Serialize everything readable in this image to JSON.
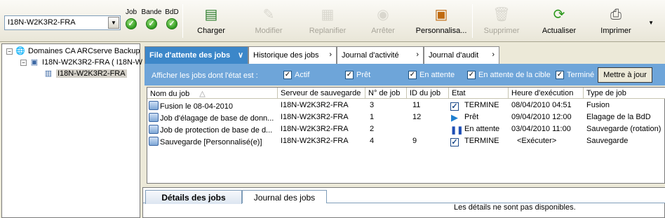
{
  "toolbar": {
    "server_value": "I18N-W2K3R2-FRA",
    "status": [
      {
        "label": "Job",
        "icon": "status-ok-icon"
      },
      {
        "label": "Bande",
        "icon": "status-ok-icon"
      },
      {
        "label": "BdD",
        "icon": "status-ok-icon"
      }
    ],
    "buttons": [
      {
        "label": "Charger",
        "icon": "load-icon",
        "enabled": true
      },
      {
        "label": "Modifier",
        "icon": "edit-icon",
        "enabled": false
      },
      {
        "label": "Replanifier",
        "icon": "reschedule-icon",
        "enabled": false
      },
      {
        "label": "Arrêter",
        "icon": "stop-icon",
        "enabled": false
      },
      {
        "label": "Personnalisa...",
        "icon": "customize-icon",
        "enabled": true
      },
      {
        "label": "Supprimer",
        "icon": "delete-icon",
        "enabled": false
      },
      {
        "label": "Actualiser",
        "icon": "refresh-icon",
        "enabled": true
      },
      {
        "label": "Imprimer",
        "icon": "print-icon",
        "enabled": true
      }
    ]
  },
  "tree": {
    "root": "Domaines CA ARCserve Backup",
    "domain": "I18N-W2K3R2-FRA ( I18N-W",
    "server": "I18N-W2K3R2-FRA"
  },
  "tabs": [
    {
      "label": "File d'attente des jobs",
      "active": true
    },
    {
      "label": "Historique des jobs",
      "active": false
    },
    {
      "label": "Journal d'activité",
      "active": false
    },
    {
      "label": "Journal d'audit",
      "active": false
    }
  ],
  "filter": {
    "title": "Afficher les jobs dont l'état est :",
    "options": [
      {
        "label": "Actif",
        "checked": true
      },
      {
        "label": "Prêt",
        "checked": true
      },
      {
        "label": "En attente",
        "checked": true
      },
      {
        "label": "En attente de la cible",
        "checked": true
      },
      {
        "label": "Terminé",
        "checked": true
      }
    ],
    "update_button": "Mettre à jour"
  },
  "grid": {
    "columns": [
      "Nom du job",
      "Serveur de sauvegarde",
      "N° de job",
      "ID du job",
      "Etat",
      "Heure d'exécution",
      "Type de job"
    ],
    "rows": [
      {
        "name": "Fusion le 08-04-2010",
        "server": "I18N-W2K3R2-FRA",
        "job_no": "3",
        "job_id": "11",
        "state": "TERMINE",
        "state_icon": "done-check-icon",
        "time": "08/04/2010  04:51",
        "type": "Fusion"
      },
      {
        "name": "Job d'élagage de base de donn...",
        "server": "I18N-W2K3R2-FRA",
        "job_no": "1",
        "job_id": "12",
        "state": "Prêt",
        "state_icon": "ready-icon",
        "time": "09/04/2010  12:00",
        "type": "Elagage de la BdD"
      },
      {
        "name": "Job de protection de base de d...",
        "server": "I18N-W2K3R2-FRA",
        "job_no": "2",
        "job_id": "",
        "state": "En attente",
        "state_icon": "pause-icon",
        "time": "03/04/2010  11:00",
        "type": "Sauvegarde (rotation)"
      },
      {
        "name": "Sauvegarde [Personnalisé(e)]",
        "server": "I18N-W2K3R2-FRA",
        "job_no": "4",
        "job_id": "9",
        "state": "TERMINE",
        "state_icon": "done-check-icon",
        "time": "<Exécuter>",
        "type": "Sauvegarde"
      }
    ]
  },
  "details": {
    "tabs": [
      "Détails des jobs",
      "Journal des jobs"
    ],
    "message": "Les détails ne sont pas disponibles."
  },
  "colors": {
    "tab_active": "#3c87c9",
    "filter_bar": "#6ea5d9",
    "status_ok": "#2f9a1f"
  }
}
